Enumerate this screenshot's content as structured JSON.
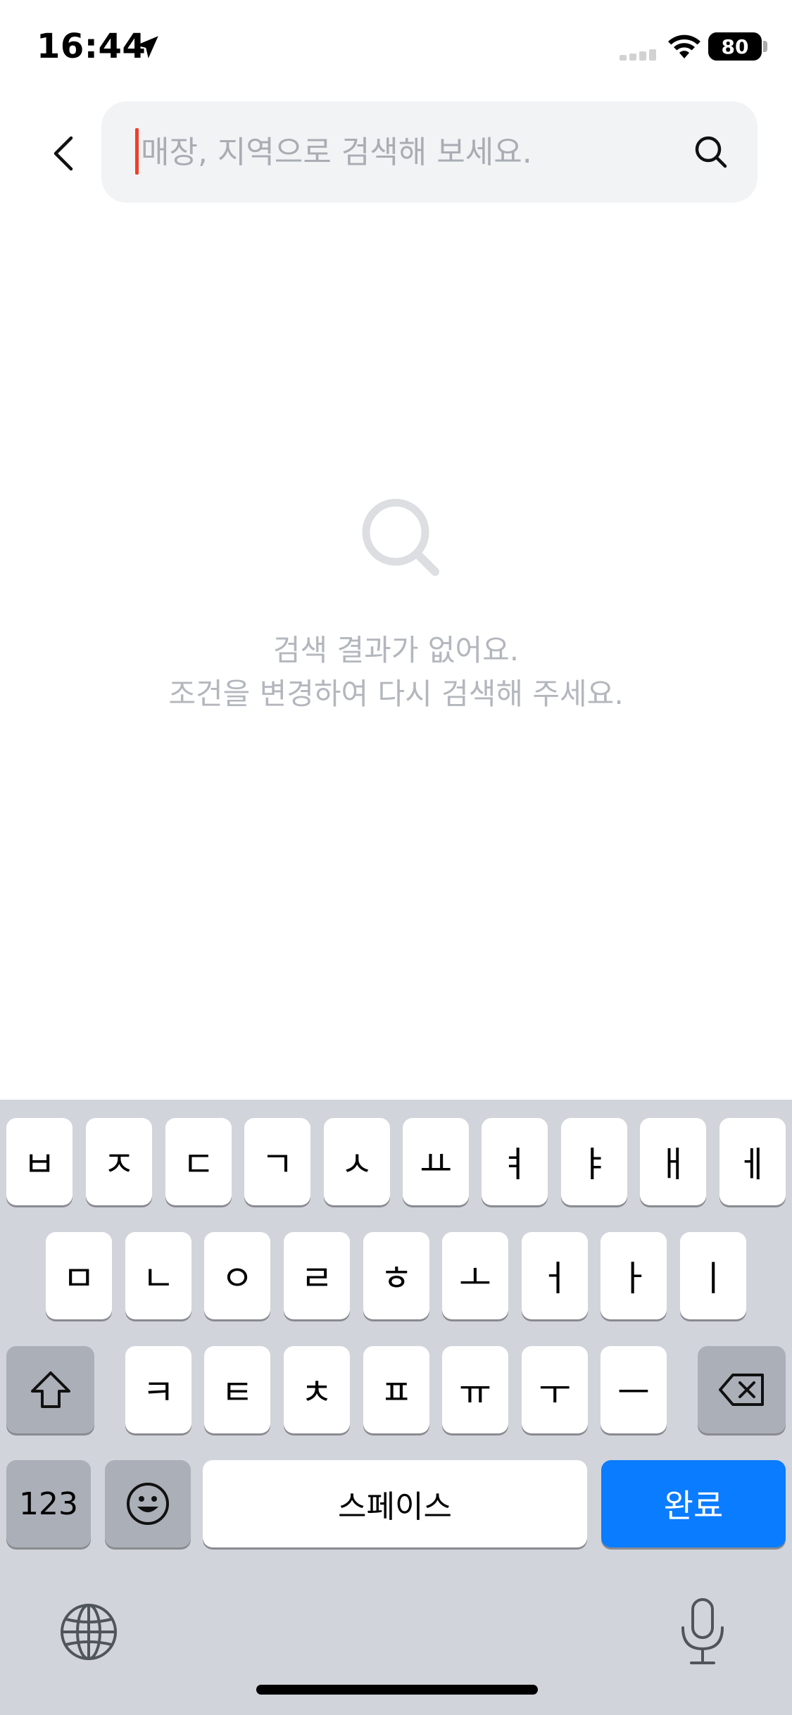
{
  "status_bar": {
    "time": "16:44",
    "battery": "80"
  },
  "header": {
    "back_icon": "chevron-left-icon",
    "search": {
      "placeholder": "매장, 지역으로 검색해 보세요.",
      "value": "",
      "icon": "search-icon"
    }
  },
  "empty_state": {
    "icon": "search-icon",
    "line1": "검색 결과가 없어요.",
    "line2": "조건을 변경하여 다시 검색해 주세요."
  },
  "keyboard": {
    "row1": [
      "ㅂ",
      "ㅈ",
      "ㄷ",
      "ㄱ",
      "ㅅ",
      "ㅛ",
      "ㅕ",
      "ㅑ",
      "ㅐ",
      "ㅔ"
    ],
    "row2": [
      "ㅁ",
      "ㄴ",
      "ㅇ",
      "ㄹ",
      "ㅎ",
      "ㅗ",
      "ㅓ",
      "ㅏ",
      "ㅣ"
    ],
    "row3": [
      "ㅋ",
      "ㅌ",
      "ㅊ",
      "ㅍ",
      "ㅠ",
      "ㅜ",
      "ㅡ"
    ],
    "numbers_label": "123",
    "space_label": "스페이스",
    "done_label": "완료",
    "colors": {
      "background": "#d1d4da",
      "key": "#ffffff",
      "function_key": "#abafb8",
      "done": "#0a7cff"
    }
  },
  "colors": {
    "caret": "#ef3e2b",
    "placeholder": "#a9adb3",
    "empty_text": "#b3b7bd",
    "search_bg": "#f2f3f5"
  }
}
